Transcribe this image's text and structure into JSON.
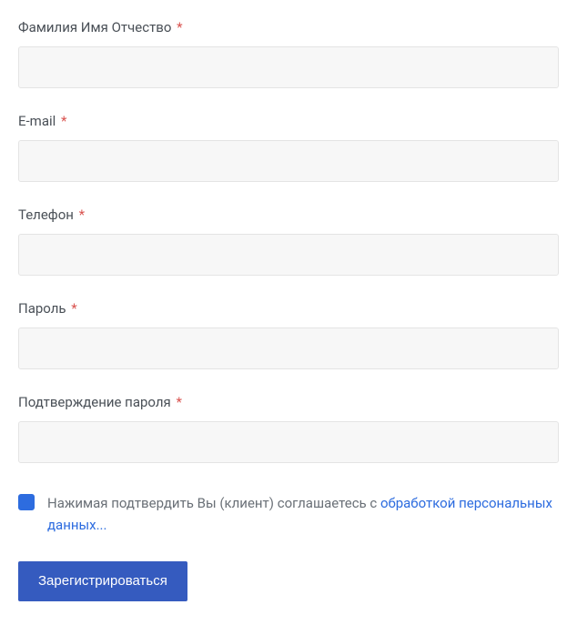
{
  "fields": {
    "fullname": {
      "label": "Фамилия Имя Отчество",
      "value": ""
    },
    "email": {
      "label": "E-mail",
      "value": ""
    },
    "phone": {
      "label": "Телефон",
      "value": ""
    },
    "password": {
      "label": "Пароль",
      "value": ""
    },
    "confirm": {
      "label": "Подтверждение пароля",
      "value": ""
    }
  },
  "required_marker": "*",
  "consent": {
    "text_before": "Нажимая подтвердить Вы (клиент) соглашаетесь с ",
    "link_text": "обработкой персональных данных...",
    "checked": true
  },
  "submit": {
    "label": "Зарегистрироваться"
  }
}
